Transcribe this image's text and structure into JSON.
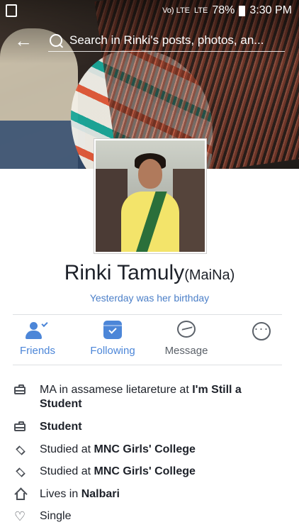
{
  "status_bar": {
    "left_icon": "screenshot-icon",
    "network": "Vo) LTE",
    "signal_label": "LTE",
    "battery": "78%",
    "time": "3:30 PM"
  },
  "header": {
    "back_icon": "back-arrow-icon",
    "search_placeholder": "Search in Rinki's posts, photos, an..."
  },
  "profile": {
    "name": "Rinki Tamuly",
    "alternate_name": "(MaiNa)",
    "birthday_note": "Yesterday was her birthday"
  },
  "actions": [
    {
      "label": "Friends",
      "icon": "friends-icon",
      "color": "#4c86d8"
    },
    {
      "label": "Following",
      "icon": "following-icon",
      "color": "#4c86d8"
    },
    {
      "label": "Message",
      "icon": "messenger-icon",
      "color": "#5b6169"
    },
    {
      "label": "",
      "icon": "more-icon",
      "color": "#5b6169"
    }
  ],
  "info": [
    {
      "icon": "briefcase-icon",
      "prefix": "MA in assamese lietareture at ",
      "bold": "I'm Still a Student"
    },
    {
      "icon": "briefcase-icon",
      "prefix": "",
      "bold": "Student"
    },
    {
      "icon": "graduation-cap-icon",
      "prefix": "Studied at ",
      "bold": "MNC Girls' College"
    },
    {
      "icon": "graduation-cap-icon",
      "prefix": "Studied at ",
      "bold": "MNC Girls' College"
    },
    {
      "icon": "home-icon",
      "prefix": "Lives in ",
      "bold": "Nalbari"
    },
    {
      "icon": "heart-icon",
      "prefix": "Single",
      "bold": ""
    }
  ]
}
